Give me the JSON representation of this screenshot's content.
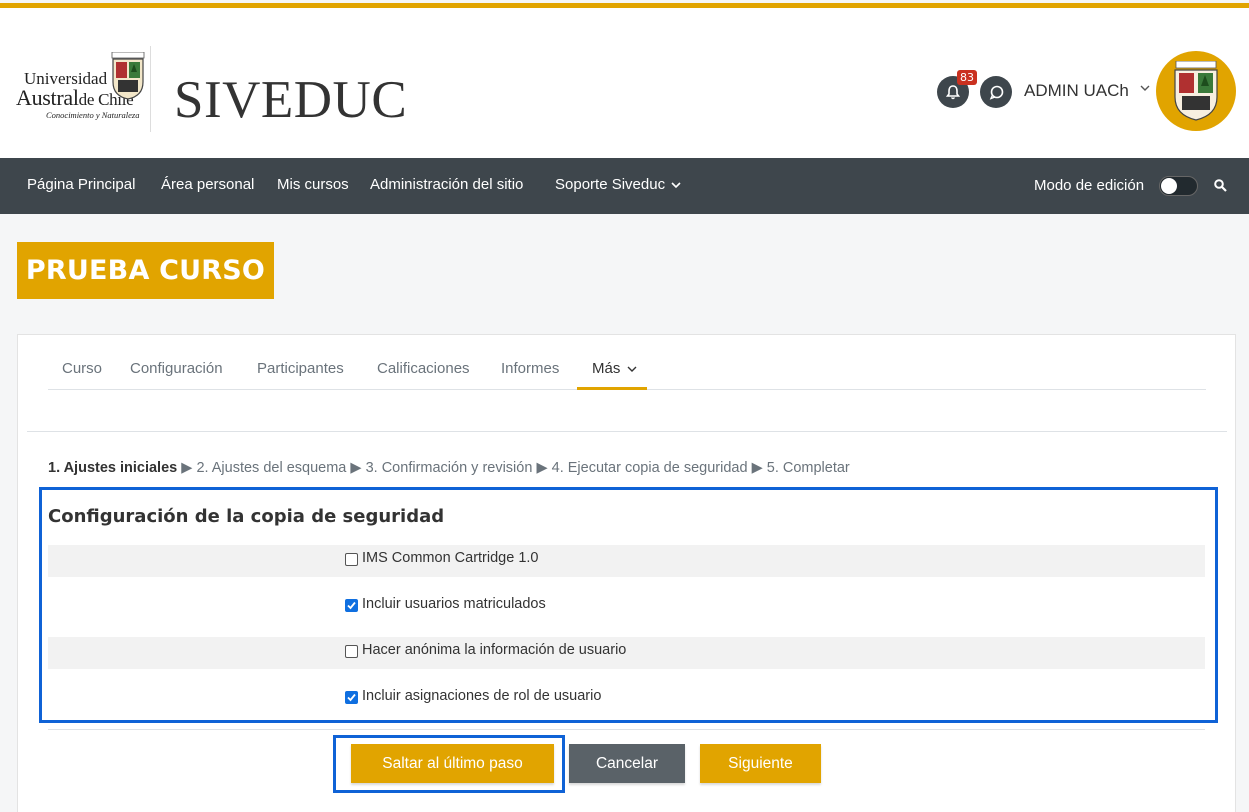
{
  "header": {
    "logo_line1": "Universidad",
    "logo_line2_a": "Austral",
    "logo_line2_b": "de Chile",
    "logo_tagline": "Conocimiento y Naturaleza",
    "site_name": "SIVEDUC",
    "notification_count": "83",
    "user_name": "ADMIN UACh"
  },
  "nav": {
    "items": [
      "Página Principal",
      "Área personal",
      "Mis cursos",
      "Administración del sitio",
      "Soporte Siveduc"
    ],
    "edit_mode_label": "Modo de edición",
    "edit_mode_on": false
  },
  "course": {
    "title": "PRUEBA CURSO"
  },
  "tabs": {
    "items": [
      "Curso",
      "Configuración",
      "Participantes",
      "Calificaciones",
      "Informes",
      "Más"
    ],
    "active": "Más"
  },
  "steps": {
    "current": "1. Ajustes iniciales",
    "rest": [
      "2. Ajustes del esquema",
      "3. Confirmación y revisión",
      "4. Ejecutar copia de seguridad",
      "5. Completar"
    ],
    "separator": "▶"
  },
  "section": {
    "title": "Configuración de la copia de seguridad",
    "options": [
      {
        "label": "IMS Common Cartridge 1.0",
        "checked": false
      },
      {
        "label": "Incluir usuarios matriculados",
        "checked": true
      },
      {
        "label": "Hacer anónima la información de usuario",
        "checked": false
      },
      {
        "label": "Incluir asignaciones de rol de usuario",
        "checked": true
      }
    ]
  },
  "buttons": {
    "skip": "Saltar al último paso",
    "cancel": "Cancelar",
    "next": "Siguiente"
  },
  "colors": {
    "brand": "#e1a400",
    "nav_bg": "#3e464c",
    "highlight": "#0f62d6"
  }
}
